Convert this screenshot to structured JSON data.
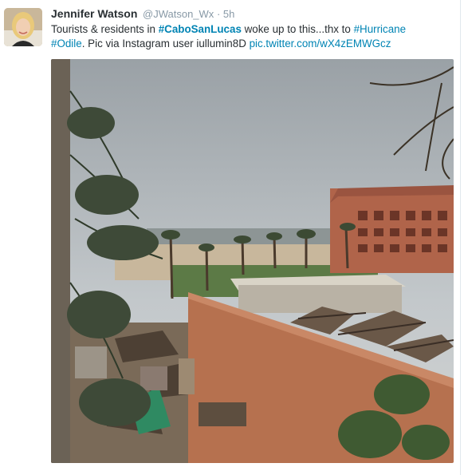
{
  "tweet": {
    "author_name": "Jennifer Watson",
    "handle": "@JWatson_Wx",
    "separator": "·",
    "time": "5h",
    "text_1": "Tourists & residents in ",
    "hashtag_1": "#CaboSanLucas",
    "text_2": " woke up to this...thx to ",
    "hashtag_2": "#Hurricane",
    "hashtag_3": "#Odile",
    "text_3": ". Pic via Instagram user iullumin8D ",
    "link": "pic.twitter.com/wX4zEMWGcz"
  },
  "icons": {
    "avatar": "profile-photo",
    "media": "hurricane-damage-photo"
  },
  "colors": {
    "link": "#0084b4",
    "name": "#292f33",
    "meta": "#8899a6"
  }
}
